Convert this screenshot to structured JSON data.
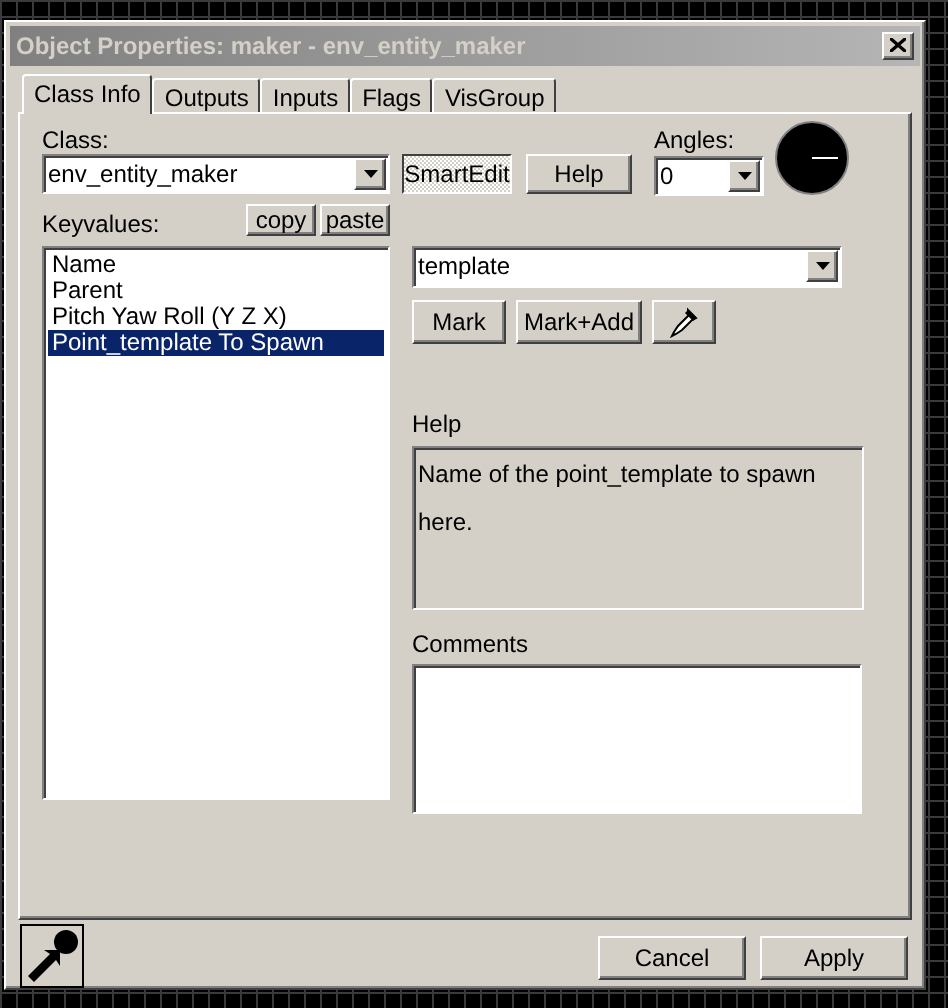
{
  "window": {
    "title": "Object Properties: maker - env_entity_maker"
  },
  "tabs": [
    {
      "label": "Class Info",
      "selected": true
    },
    {
      "label": "Outputs",
      "selected": false
    },
    {
      "label": "Inputs",
      "selected": false
    },
    {
      "label": "Flags",
      "selected": false
    },
    {
      "label": "VisGroup",
      "selected": false
    }
  ],
  "class": {
    "label": "Class:",
    "value": "env_entity_maker"
  },
  "smart_edit": {
    "label": "SmartEdit",
    "pressed": true
  },
  "help_button": "Help",
  "angles": {
    "label": "Angles:",
    "value": "0"
  },
  "keyvalues": {
    "label": "Keyvalues:",
    "copy": "copy",
    "paste": "paste",
    "items": [
      {
        "label": "Name",
        "selected": false
      },
      {
        "label": "Parent",
        "selected": false
      },
      {
        "label": "Pitch Yaw Roll (Y Z X)",
        "selected": false
      },
      {
        "label": "Point_template To Spawn",
        "selected": true
      }
    ]
  },
  "value": "template",
  "mark_buttons": [
    "Mark",
    "Mark+Add"
  ],
  "help": {
    "label": "Help",
    "text": "Name of the point_template to spawn here."
  },
  "comments": {
    "label": "Comments"
  },
  "footer_buttons": [
    "Cancel",
    "Apply"
  ]
}
